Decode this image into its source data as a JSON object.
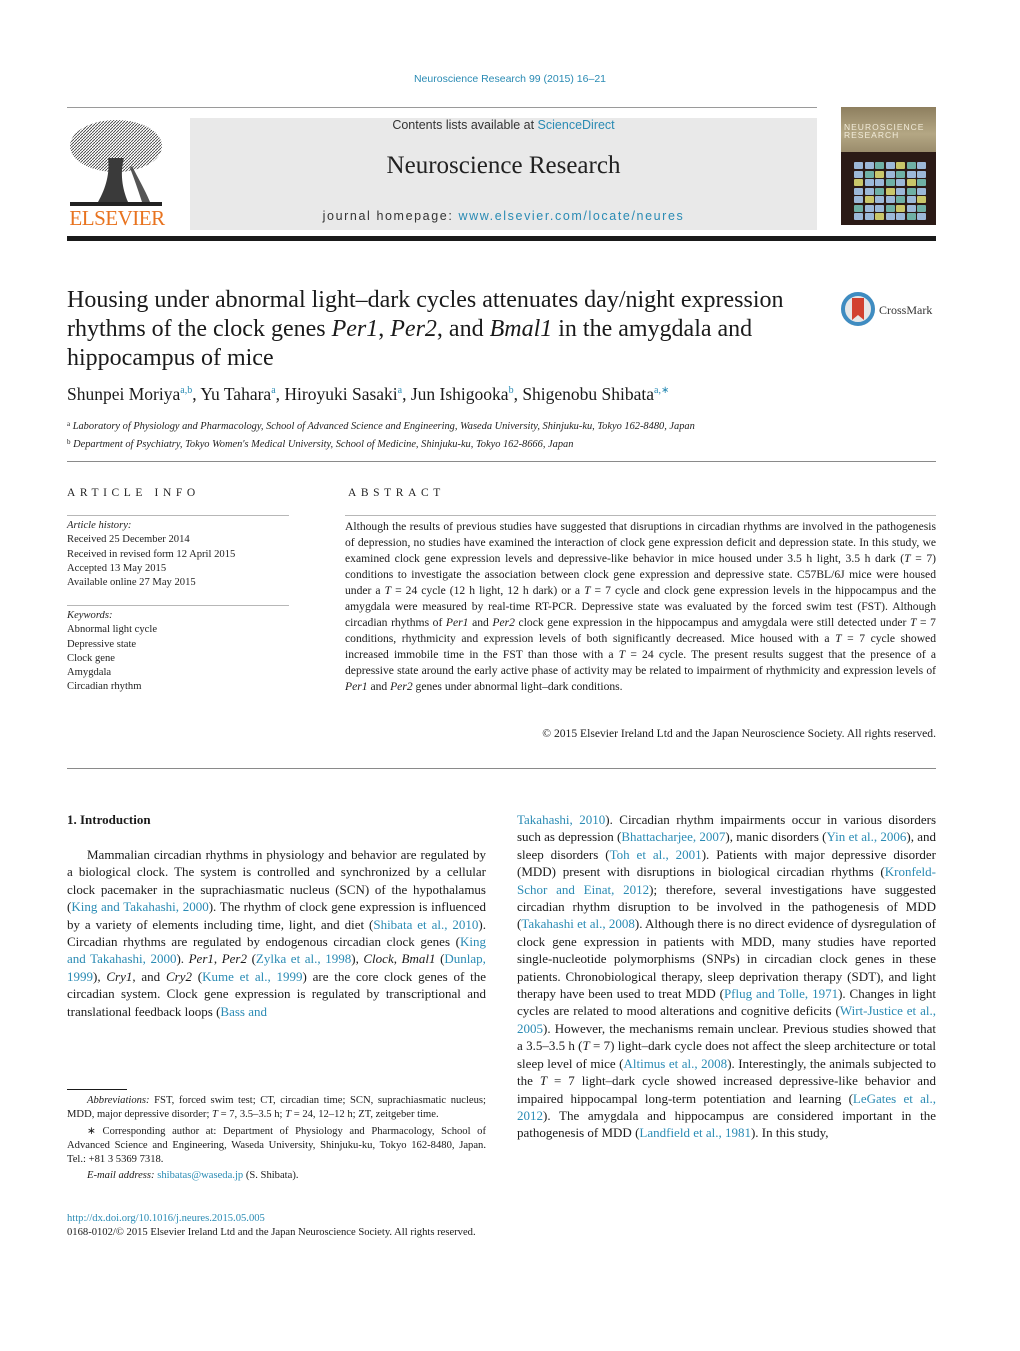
{
  "header": {
    "citation": "Neuroscience Research 99 (2015) 16–21",
    "publisher_logo_text": "ELSEVIER",
    "contents_prefix": "Contents lists available at ",
    "contents_link": "ScienceDirect",
    "journal_name": "Neuroscience Research",
    "homepage_prefix": "journal homepage: ",
    "homepage_link": "www.elsevier.com/locate/neures",
    "cover_title_line1": "NEUROSCIENCE",
    "cover_title_line2": "RESEARCH"
  },
  "colors": {
    "link": "#2a8bb4",
    "elsevier_orange": "#e8731f",
    "crossmark_red": "#d2412f",
    "crossmark_blue": "#3f8cc1"
  },
  "title": {
    "part1": "Housing under abnormal light–dark cycles attenuates day/night expression rhythms of the clock genes ",
    "gene1": "Per1",
    "sep1": ", ",
    "gene2": "Per2",
    "sep2": ", and ",
    "gene3": "Bmal1",
    "part2": " in the amygdala and hippocampus of mice"
  },
  "crossmark_label": "CrossMark",
  "authors": [
    {
      "name": "Shunpei Moriya",
      "aff": "a,b",
      "sep": ", "
    },
    {
      "name": "Yu Tahara",
      "aff": "a",
      "sep": ", "
    },
    {
      "name": "Hiroyuki Sasaki",
      "aff": "a",
      "sep": ", "
    },
    {
      "name": "Jun Ishigooka",
      "aff": "b",
      "sep": ", "
    },
    {
      "name": "Shigenobu Shibata",
      "aff": "a,∗",
      "sep": ""
    }
  ],
  "affiliations": [
    {
      "key": "a",
      "text": "Laboratory of Physiology and Pharmacology, School of Advanced Science and Engineering, Waseda University, Shinjuku-ku, Tokyo 162-8480, Japan"
    },
    {
      "key": "b",
      "text": "Department of Psychiatry, Tokyo Women's Medical University, School of Medicine, Shinjuku-ku, Tokyo 162-8666, Japan"
    }
  ],
  "article_info": {
    "heading": "ARTICLE INFO",
    "history_label": "Article history:",
    "history": [
      "Received 25 December 2014",
      "Received in revised form 12 April 2015",
      "Accepted 13 May 2015",
      "Available online 27 May 2015"
    ],
    "keywords_label": "Keywords:",
    "keywords": [
      "Abnormal light cycle",
      "Depressive state",
      "Clock gene",
      "Amygdala",
      "Circadian rhythm"
    ]
  },
  "abstract": {
    "heading": "ABSTRACT",
    "segments": [
      {
        "t": "Although the results of previous studies have suggested that disruptions in circadian rhythms are involved in the pathogenesis of depression, no studies have examined the interaction of clock gene expression deficit and depression state. In this study, we examined clock gene expression levels and depressive-like behavior in mice housed under 3.5 h light, 3.5 h dark ("
      },
      {
        "t": "T",
        "i": true
      },
      {
        "t": " = 7) conditions to investigate the association between clock gene expression and depressive state. C57BL/6J mice were housed under a "
      },
      {
        "t": "T",
        "i": true
      },
      {
        "t": " = 24 cycle (12 h light, 12 h dark) or a "
      },
      {
        "t": "T",
        "i": true
      },
      {
        "t": " = 7 cycle and clock gene expression levels in the hippocampus and the amygdala were measured by real-time RT-PCR. Depressive state was evaluated by the forced swim test (FST). Although circadian rhythms of "
      },
      {
        "t": "Per1",
        "i": true
      },
      {
        "t": " and "
      },
      {
        "t": "Per2",
        "i": true
      },
      {
        "t": " clock gene expression in the hippocampus and amygdala were still detected under "
      },
      {
        "t": "T",
        "i": true
      },
      {
        "t": " = 7 conditions, rhythmicity and expression levels of both significantly decreased. Mice housed with a "
      },
      {
        "t": "T",
        "i": true
      },
      {
        "t": " = 7 cycle showed increased immobile time in the FST than those with a "
      },
      {
        "t": "T",
        "i": true
      },
      {
        "t": " = 24 cycle. The present results suggest that the presence of a depressive state around the early active phase of activity may be related to impairment of rhythmicity and expression levels of "
      },
      {
        "t": "Per1",
        "i": true
      },
      {
        "t": " and "
      },
      {
        "t": "Per2",
        "i": true
      },
      {
        "t": " genes under abnormal light–dark conditions."
      }
    ],
    "copyright": "© 2015 Elsevier Ireland Ltd and the Japan Neuroscience Society. All rights reserved."
  },
  "introduction": {
    "heading": "1.  Introduction",
    "left_segments": [
      {
        "t": "Mammalian circadian rhythms in physiology and behavior are regulated by a biological clock. The system is controlled and synchronized by a cellular clock pacemaker in the suprachiasmatic nucleus (SCN) of the hypothalamus ("
      },
      {
        "t": "King and Takahashi, 2000",
        "l": true
      },
      {
        "t": "). The rhythm of clock gene expression is influenced by a variety of elements including time, light, and diet ("
      },
      {
        "t": "Shibata et al., 2010",
        "l": true
      },
      {
        "t": "). Circadian rhythms are regulated by endogenous circadian clock genes ("
      },
      {
        "t": "King and Takahashi, 2000",
        "l": true
      },
      {
        "t": "). "
      },
      {
        "t": "Per1",
        "i": true
      },
      {
        "t": ", "
      },
      {
        "t": "Per2",
        "i": true
      },
      {
        "t": " ("
      },
      {
        "t": "Zylka et al., 1998",
        "l": true
      },
      {
        "t": "), "
      },
      {
        "t": "Clock",
        "i": true
      },
      {
        "t": ", "
      },
      {
        "t": "Bmal1",
        "i": true
      },
      {
        "t": " ("
      },
      {
        "t": "Dunlap, 1999",
        "l": true
      },
      {
        "t": "), "
      },
      {
        "t": "Cry1",
        "i": true
      },
      {
        "t": ", and "
      },
      {
        "t": "Cry2",
        "i": true
      },
      {
        "t": " ("
      },
      {
        "t": "Kume et al., 1999",
        "l": true
      },
      {
        "t": ") are the core clock genes of the circadian system. Clock gene expression is regulated by transcriptional and translational feedback loops ("
      },
      {
        "t": "Bass and",
        "l": true
      }
    ],
    "right_segments": [
      {
        "t": "Takahashi, 2010",
        "l": true
      },
      {
        "t": "). Circadian rhythm impairments occur in various disorders such as depression ("
      },
      {
        "t": "Bhattacharjee, 2007",
        "l": true
      },
      {
        "t": "), manic disorders ("
      },
      {
        "t": "Yin et al., 2006",
        "l": true
      },
      {
        "t": "), and sleep disorders ("
      },
      {
        "t": "Toh et al., 2001",
        "l": true
      },
      {
        "t": "). Patients with major depressive disorder (MDD) present with disruptions in biological circadian rhythms ("
      },
      {
        "t": "Kronfeld-Schor and Einat, 2012",
        "l": true
      },
      {
        "t": "); therefore, several investigations have suggested circadian rhythm disruption to be involved in the pathogenesis of MDD ("
      },
      {
        "t": "Takahashi et al., 2008",
        "l": true
      },
      {
        "t": "). Although there is no direct evidence of dysregulation of clock gene expression in patients with MDD, many studies have reported single-nucleotide polymorphisms (SNPs) in circadian clock genes in these patients. Chronobiological therapy, sleep deprivation therapy (SDT), and light therapy have been used to treat MDD ("
      },
      {
        "t": "Pflug and Tolle, 1971",
        "l": true
      },
      {
        "t": "). Changes in light cycles are related to mood alterations and cognitive deficits ("
      },
      {
        "t": "Wirt-Justice et al., 2005",
        "l": true
      },
      {
        "t": "). However, the mechanisms remain unclear. Previous studies showed that a 3.5–3.5 h ("
      },
      {
        "t": "T",
        "i": true
      },
      {
        "t": " = 7) light–dark cycle does not affect the sleep architecture or total sleep level of mice ("
      },
      {
        "t": "Altimus et al., 2008",
        "l": true
      },
      {
        "t": "). Interestingly, the animals subjected to the "
      },
      {
        "t": "T",
        "i": true
      },
      {
        "t": " = 7 light–dark cycle showed increased depressive-like behavior and impaired hippocampal long-term potentiation and learning ("
      },
      {
        "t": "LeGates et al., 2012",
        "l": true
      },
      {
        "t": "). The amygdala and hippocampus are considered important in the pathogenesis of MDD ("
      },
      {
        "t": "Landfield et al., 1981",
        "l": true
      },
      {
        "t": "). In this study,"
      }
    ]
  },
  "footnotes": {
    "abbrev_label": "Abbreviations:",
    "abbrev_segments": [
      {
        "t": "  FST, forced swim test; CT, circadian time; SCN, suprachiasmatic nucleus; MDD, major depressive disorder; "
      },
      {
        "t": "T",
        "i": true
      },
      {
        "t": " = 7, 3.5–3.5 h; "
      },
      {
        "t": "T",
        "i": true
      },
      {
        "t": " = 24, 12–12 h; ZT, zeitgeber time."
      }
    ],
    "corresponding": "∗  Corresponding author at: Department of Physiology and Pharmacology, School of Advanced Science and Engineering, Waseda University, Shinjuku-ku, Tokyo 162-8480, Japan. Tel.: +81 3 5369 7318.",
    "email_label": "E-mail address:",
    "email": "shibatas@waseda.jp",
    "email_suffix": " (S. Shibata)."
  },
  "footer": {
    "doi": "http://dx.doi.org/10.1016/j.neures.2015.05.005",
    "issn_line": "0168-0102/© 2015 Elsevier Ireland Ltd and the Japan Neuroscience Society. All rights reserved."
  }
}
